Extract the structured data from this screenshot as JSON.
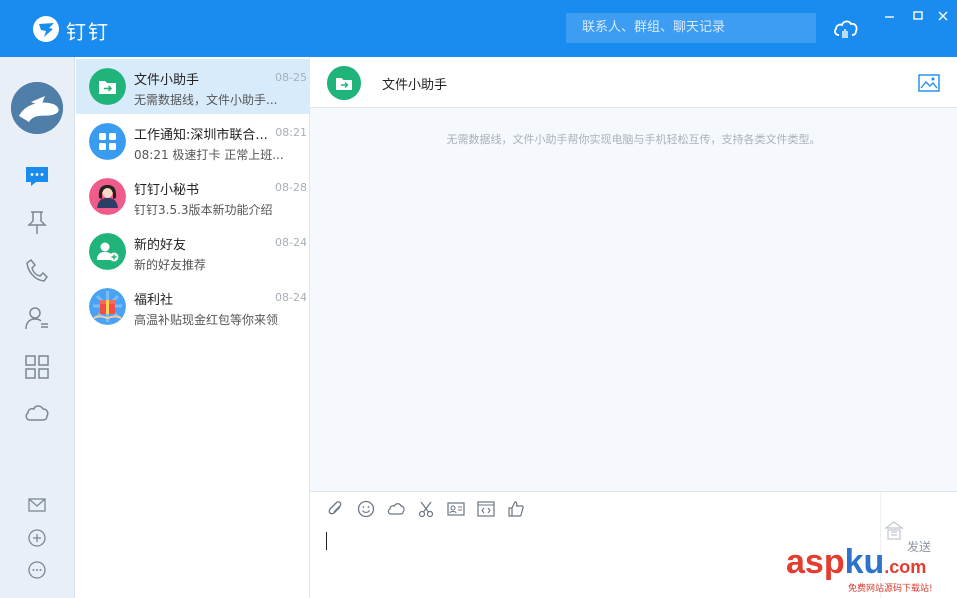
{
  "app": {
    "brand": "钉钉"
  },
  "header": {
    "search_placeholder": "联系人、群组、聊天记录"
  },
  "rail": {
    "icons": [
      "chat-icon",
      "pin-icon",
      "phone-icon",
      "contacts-icon",
      "apps-icon",
      "cloud-icon",
      "mail-icon",
      "plus-icon",
      "more-icon"
    ]
  },
  "conversations": [
    {
      "name": "文件小助手",
      "date": "08-25",
      "snippet": "无需数据线，文件小助手...",
      "active": true
    },
    {
      "name": "工作通知:深圳市联合...",
      "date": "08:21",
      "snippet": "08:21 极速打卡 正常上班..."
    },
    {
      "name": "钉钉小秘书",
      "date": "08-28",
      "snippet": "钉钉3.5.3版本新功能介绍"
    },
    {
      "name": "新的好友",
      "date": "08-24",
      "snippet": "新的好友推荐"
    },
    {
      "name": "福利社",
      "date": "08-24",
      "snippet": "高温补贴现金红包等你来领"
    }
  ],
  "chat": {
    "title": "文件小助手",
    "system_message": "无需数据线，文件小助手帮你实现电脑与手机轻松互传，支持各类文件类型。",
    "send_label": "发送"
  },
  "watermark": {
    "asp": "asp",
    "ku": "ku",
    "com": ".com",
    "sub": "免费网站源码下载站!"
  },
  "colors": {
    "titlebar": "#1b8cef",
    "accent": "#1b8cef",
    "file_helper": "#21b47a",
    "work": "#3a9cf0"
  }
}
